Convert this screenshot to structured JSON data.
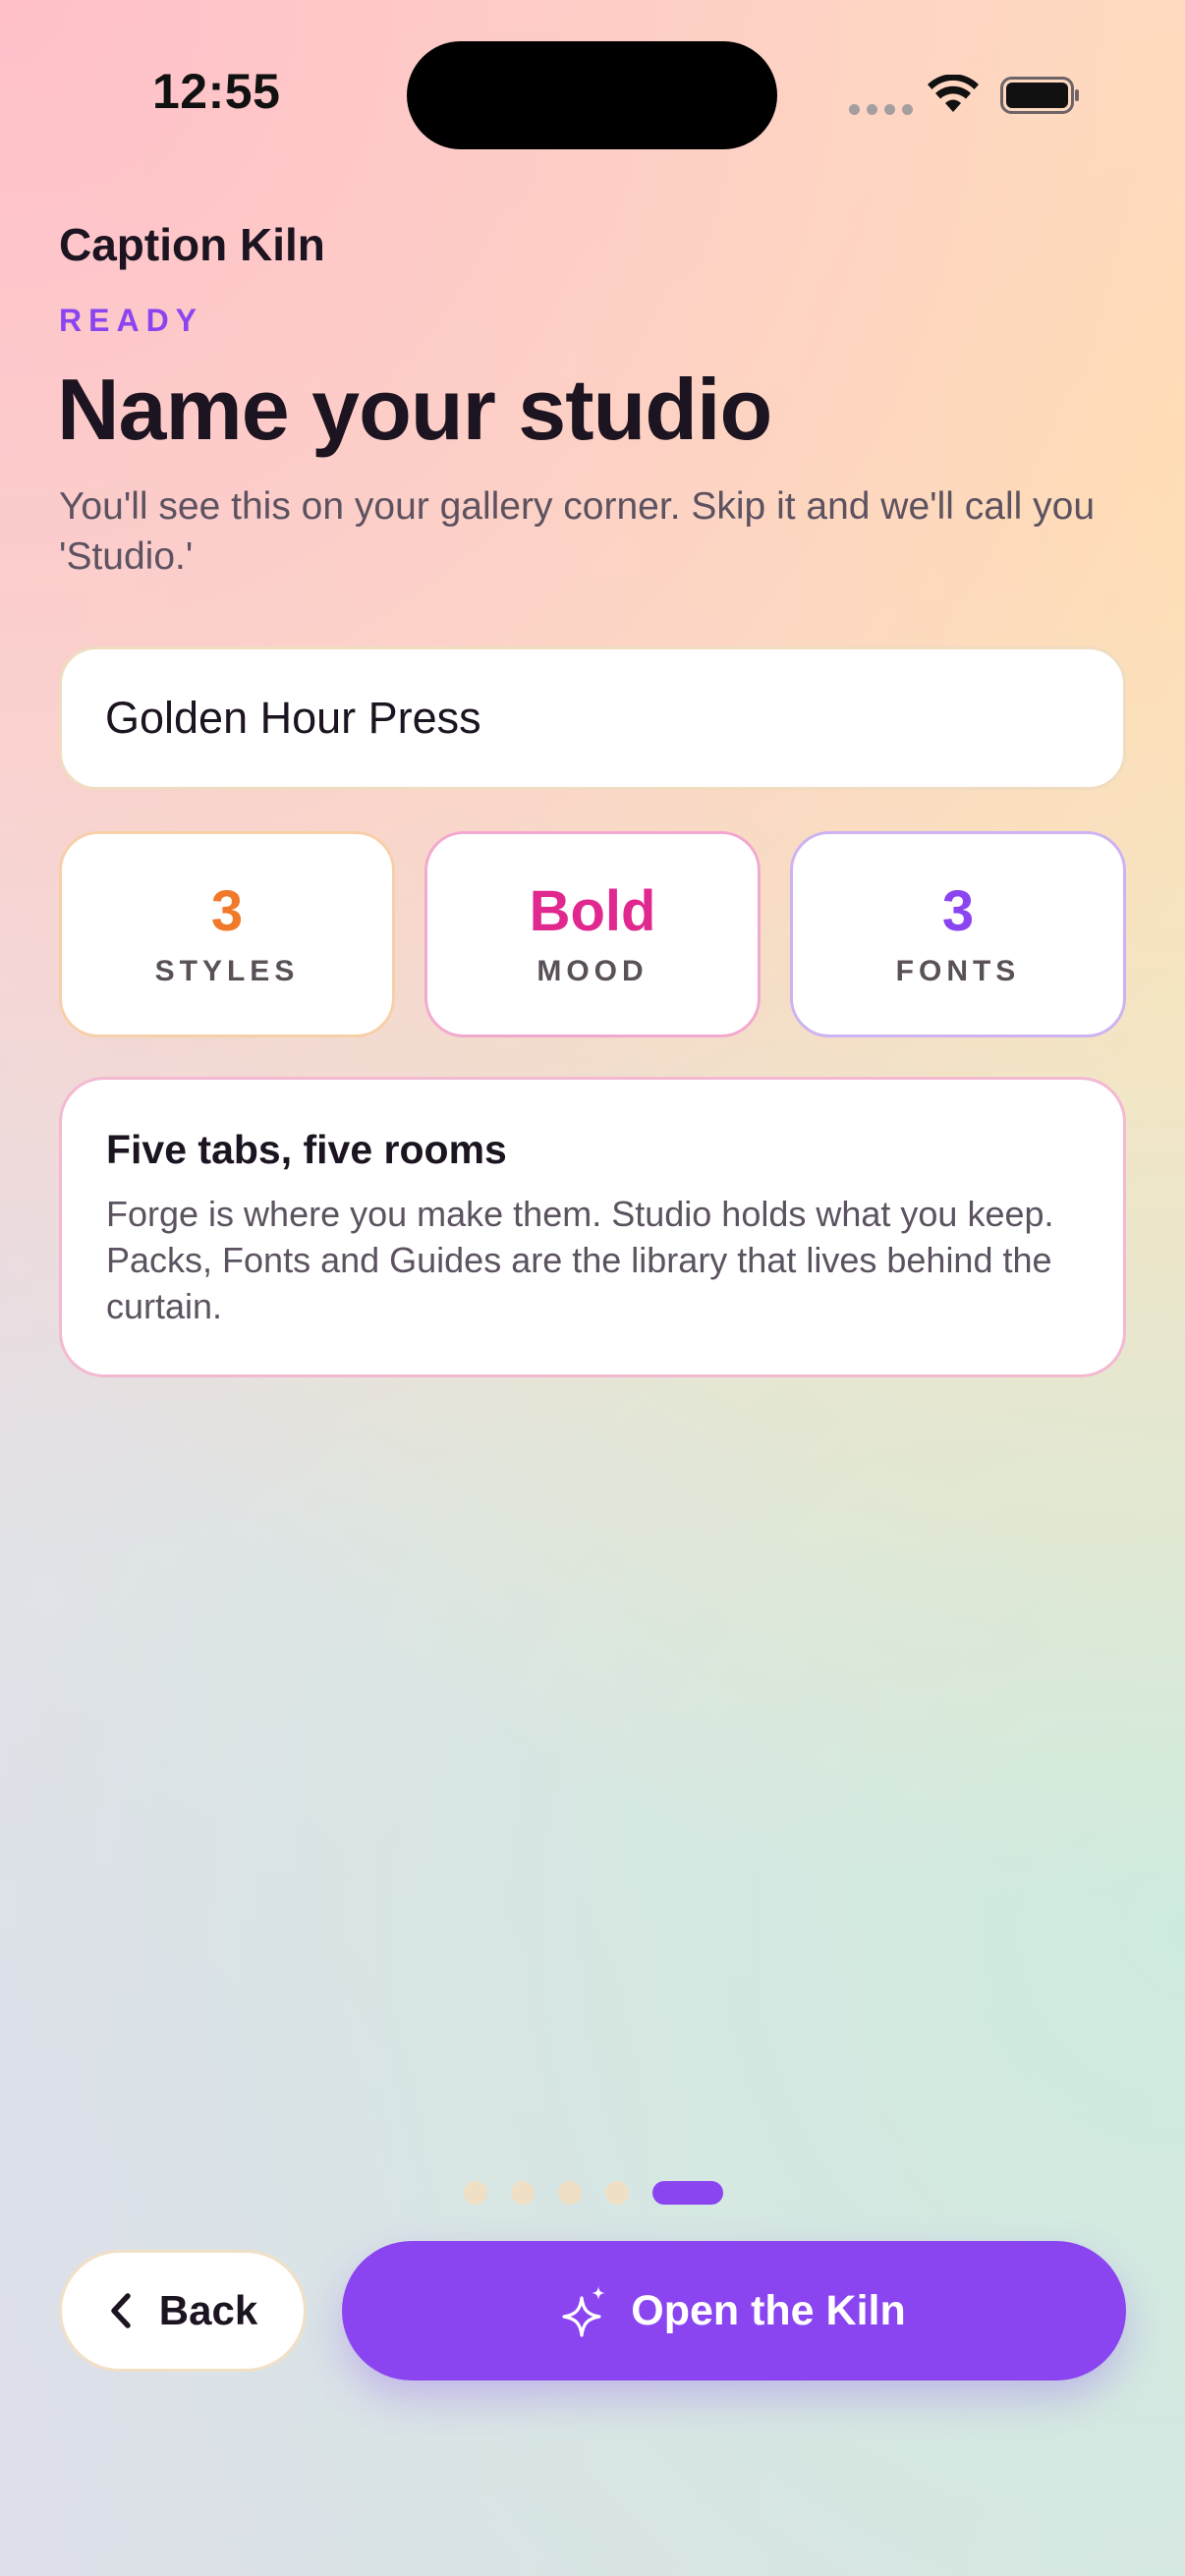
{
  "status_bar": {
    "time": "12:55"
  },
  "header": {
    "app_title": "Caption Kiln",
    "step_label": "READY",
    "page_title": "Name your studio",
    "subtitle": "You'll see this on your gallery corner. Skip it and we'll call you 'Studio.'"
  },
  "studio_name_input": {
    "value": "Golden Hour Press"
  },
  "stats": [
    {
      "value": "3",
      "label": "STYLES",
      "color": "#f07a2a"
    },
    {
      "value": "Bold",
      "label": "MOOD",
      "color": "#e1288f"
    },
    {
      "value": "3",
      "label": "FONTS",
      "color": "#8a45f0"
    }
  ],
  "info_card": {
    "title": "Five tabs, five rooms",
    "body": "Forge is where you make them. Studio holds what you keep. Packs, Fonts and Guides are the library that lives behind the curtain."
  },
  "pagination": {
    "total": 5,
    "current": 5
  },
  "footer": {
    "back_label": "Back",
    "back_icon": "chevron-left-icon",
    "primary_label": "Open the Kiln",
    "primary_icon": "sparkle-icon"
  },
  "colors": {
    "accent": "#8a45f0",
    "orange": "#f07a2a",
    "pink": "#e1288f"
  }
}
